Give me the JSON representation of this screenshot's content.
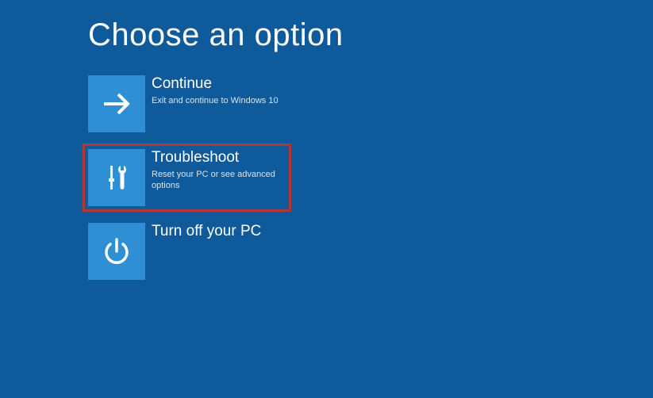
{
  "page": {
    "title": "Choose an option"
  },
  "options": {
    "continue": {
      "title": "Continue",
      "description": "Exit and continue to Windows 10"
    },
    "troubleshoot": {
      "title": "Troubleshoot",
      "description": "Reset your PC or see advanced options"
    },
    "turnoff": {
      "title": "Turn off your PC",
      "description": ""
    }
  },
  "colors": {
    "background": "#0f5a9a",
    "tile": "#2e8fd4",
    "highlight_border": "#b43535"
  }
}
